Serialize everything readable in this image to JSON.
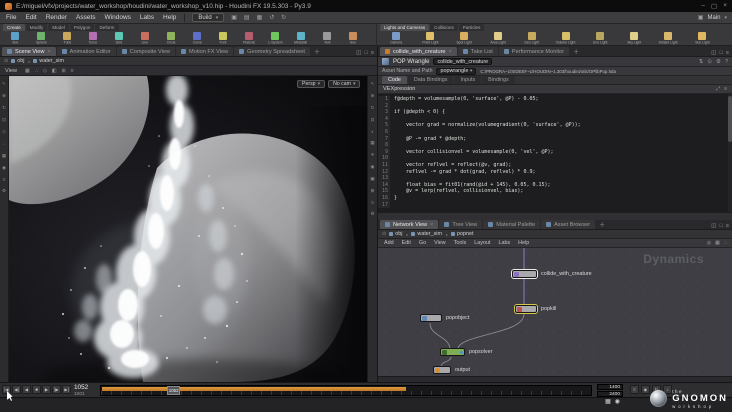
{
  "title_bar": {
    "title": "E:/miguel/vfx/projects/water_workshop/houdini/water_workshop_v10.hip - Houdini FX 19.5.303 - Py3.9",
    "window_icons": [
      {
        "name": "minimize-icon",
        "glyph": "–"
      },
      {
        "name": "maximize-icon",
        "glyph": "▢"
      },
      {
        "name": "close-icon",
        "glyph": "×"
      }
    ]
  },
  "menu_bar": {
    "items": [
      "File",
      "Edit",
      "Render",
      "Assets",
      "Windows",
      "Labs",
      "Help"
    ],
    "desktop_selector": "Build",
    "toolbar_icons": [
      {
        "name": "new-scene-icon",
        "glyph": "▣"
      },
      {
        "name": "open-scene-icon",
        "glyph": "▤"
      },
      {
        "name": "save-scene-icon",
        "glyph": "▦"
      },
      {
        "name": "undo-icon",
        "glyph": "↺"
      },
      {
        "name": "redo-icon",
        "glyph": "↻"
      }
    ],
    "right_label": "Main"
  },
  "shelf": {
    "left_tabs": [
      "Create",
      "Modify",
      "Model",
      "Polygon",
      "Deform"
    ],
    "right_tabs": [
      "Lights and Cameras",
      "Collisions",
      "Particles"
    ],
    "left_tools": [
      "Box",
      "Sphere",
      "Tube",
      "Torus",
      "Grid",
      "Line",
      "Circle",
      "Curve",
      "Font",
      "Platonic",
      "L-System",
      "Metaball",
      "Null",
      "Geo"
    ],
    "right_tools": [
      "Camera",
      "Point Light",
      "Spot Light",
      "Area Light",
      "Geo Light",
      "Volume Light",
      "Env Light",
      "Sky Light",
      "Distant Light",
      "Sun Light"
    ]
  },
  "scene_pane": {
    "tabs": [
      "Scene View",
      "Animation Editor",
      "Composite View",
      "Motion FX View",
      "Geometry Spreadsheet"
    ],
    "pane_icons": [
      {
        "name": "pane-split-icon",
        "glyph": "◫"
      },
      {
        "name": "pane-maximize-icon",
        "glyph": "□"
      },
      {
        "name": "pane-menu-icon",
        "glyph": "≡"
      }
    ],
    "path": [
      "obj",
      "water_sim"
    ],
    "view_label": "View",
    "top_icons": [
      {
        "name": "snap-grid-icon",
        "glyph": "▦"
      },
      {
        "name": "point-snap-icon",
        "glyph": "∴"
      },
      {
        "name": "multi-snap-icon",
        "glyph": "◇"
      },
      {
        "name": "construction-plane-icon",
        "glyph": "◧"
      },
      {
        "name": "reference-plane-icon",
        "glyph": "⊞"
      },
      {
        "name": "view-options-icon",
        "glyph": "≡"
      }
    ],
    "camera_pills": [
      "Persp",
      "No cam"
    ],
    "left_rail": [
      {
        "name": "select-tool-icon",
        "glyph": "↖"
      },
      {
        "name": "translate-tool-icon",
        "glyph": "⊕"
      },
      {
        "name": "rotate-tool-icon",
        "glyph": "↻"
      },
      {
        "name": "scale-tool-icon",
        "glyph": "⊡"
      },
      {
        "name": "pose-tool-icon",
        "glyph": "◇"
      },
      {
        "name": "snap-tool-icon",
        "glyph": "∴"
      },
      {
        "name": "grid-tool-icon",
        "glyph": "▦"
      },
      {
        "name": "camera-tool-icon",
        "glyph": "◉"
      },
      {
        "name": "menu-tool-icon",
        "glyph": "≡"
      },
      {
        "name": "settings-tool-icon",
        "glyph": "⚙"
      }
    ],
    "right_rail": [
      {
        "name": "view-select-icon",
        "glyph": "↖"
      },
      {
        "name": "view-pan-icon",
        "glyph": "⊕"
      },
      {
        "name": "view-rotate-icon",
        "glyph": "↻"
      },
      {
        "name": "view-zoom-icon",
        "glyph": "⊡"
      },
      {
        "name": "shading-mode-icon",
        "glyph": "◐"
      },
      {
        "name": "wireframe-icon",
        "glyph": "▦"
      },
      {
        "name": "lighting-icon",
        "glyph": "☀"
      },
      {
        "name": "camera-view-icon",
        "glyph": "◉"
      },
      {
        "name": "frame-view-icon",
        "glyph": "▣"
      },
      {
        "name": "grid-toggle-icon",
        "glyph": "⊞"
      },
      {
        "name": "display-options-icon",
        "glyph": "≡"
      },
      {
        "name": "viewport-settings-icon",
        "glyph": "⚙"
      }
    ]
  },
  "param_pane": {
    "tabs": [
      "collide_with_creature",
      "Take List",
      "Performance Monitor"
    ],
    "pane_icons": [
      {
        "name": "pane-split-icon",
        "glyph": "◫"
      },
      {
        "name": "pane-maximize-icon",
        "glyph": "□"
      },
      {
        "name": "pane-menu-icon",
        "glyph": "≡"
      }
    ],
    "node_type": "POP Wrangle",
    "node_name": "collide_with_creature",
    "header_icons": [
      {
        "name": "input-selector-icon",
        "glyph": "⇅"
      },
      {
        "name": "pin-icon",
        "glyph": "⊙"
      },
      {
        "name": "gear-icon",
        "glyph": "⚙"
      },
      {
        "name": "help-icon",
        "glyph": "?"
      }
    ],
    "asset_label": "Asset Name and Path",
    "asset_type": "popwrangle",
    "asset_path": "C:/PROGRA~1/SIDEEF~1/HOUDIN~1.303/houdini/otls/OPlibPop.hda",
    "param_tabs": [
      "Code",
      "Data Bindings",
      "Inputs",
      "Bindings"
    ],
    "vex_label": "VEXpression",
    "vex_icons": [
      {
        "name": "expand-editor-icon",
        "glyph": "⤢"
      },
      {
        "name": "snippet-menu-icon",
        "glyph": "≡"
      }
    ],
    "code_lines": [
      "f@depth = volumesample(0, 'surface', @P) - 0.05;",
      "",
      "if (@depth < 0) {",
      "",
      "    vector grad = normalize(volumegradient(0, 'surface', @P));",
      "",
      "    @P -= grad * @depth;",
      "",
      "    vector collisionvel = volumesample(0, 'vel', @P);",
      "",
      "    vector reflvel = reflect(@v, grad);",
      "    reflvel -= grad * dot(grad, reflvel) * 0.9;",
      "",
      "    float bias = fit01(rand(@id + 145), 0.05, 0.15);",
      "    @v = lerp(reflvel, collisionvel, bias);",
      "}",
      ""
    ]
  },
  "network_pane": {
    "tabs": [
      "Network View",
      "Tree View",
      "Material Palette",
      "Asset Browser"
    ],
    "pane_icons": [
      {
        "name": "pane-split-icon",
        "glyph": "◫"
      },
      {
        "name": "pane-maximize-icon",
        "glyph": "□"
      },
      {
        "name": "pane-menu-icon",
        "glyph": "≡"
      }
    ],
    "path": [
      "obj",
      "water_sim",
      "popnet"
    ],
    "menu": [
      "Add",
      "Edit",
      "Go",
      "View",
      "Tools",
      "Layout",
      "Labs",
      "Help"
    ],
    "menu_icons": [
      {
        "name": "net-search-icon",
        "glyph": "◎"
      },
      {
        "name": "net-overview-icon",
        "glyph": "▦"
      },
      {
        "name": "net-snap-icon",
        "glyph": "∴"
      }
    ],
    "watermark": "Dynamics",
    "nodes": [
      {
        "name": "collide_with_creature"
      },
      {
        "name": "popkill"
      },
      {
        "name": "popobject"
      },
      {
        "name": "popsolver"
      },
      {
        "name": "output"
      }
    ]
  },
  "playbar": {
    "transport": [
      {
        "name": "jump-to-start-button",
        "glyph": "|◀"
      },
      {
        "name": "step-back-button",
        "glyph": "◀|"
      },
      {
        "name": "play-reverse-button",
        "glyph": "◀"
      },
      {
        "name": "stop-button",
        "glyph": "■"
      },
      {
        "name": "play-button",
        "glyph": "▶"
      },
      {
        "name": "step-forward-button",
        "glyph": "|▶"
      },
      {
        "name": "jump-to-end-button",
        "glyph": "▶|"
      }
    ],
    "current_frame": "1052",
    "frame_start": "1001",
    "marker_label": "1052",
    "range_end": "1400",
    "global_end": "2400",
    "icons": [
      {
        "name": "playback-options-icon",
        "glyph": "≡"
      },
      {
        "name": "realtime-toggle-icon",
        "glyph": "◉"
      },
      {
        "name": "loop-mode-icon",
        "glyph": "↻"
      },
      {
        "name": "audio-icon",
        "glyph": "♪"
      }
    ]
  },
  "logo": {
    "line1": "the",
    "line2": "GNOMON",
    "line3": "workshop"
  },
  "overlay_icons": [
    {
      "name": "overlay-grid-icon",
      "glyph": "▦"
    },
    {
      "name": "overlay-camera-icon",
      "glyph": "◉"
    }
  ],
  "colors": {
    "accent_orange": "#d9822b",
    "selection_yellow": "#d8c84a",
    "wire_purple": "#9b7fd4",
    "solver_green": "#7fae54"
  }
}
